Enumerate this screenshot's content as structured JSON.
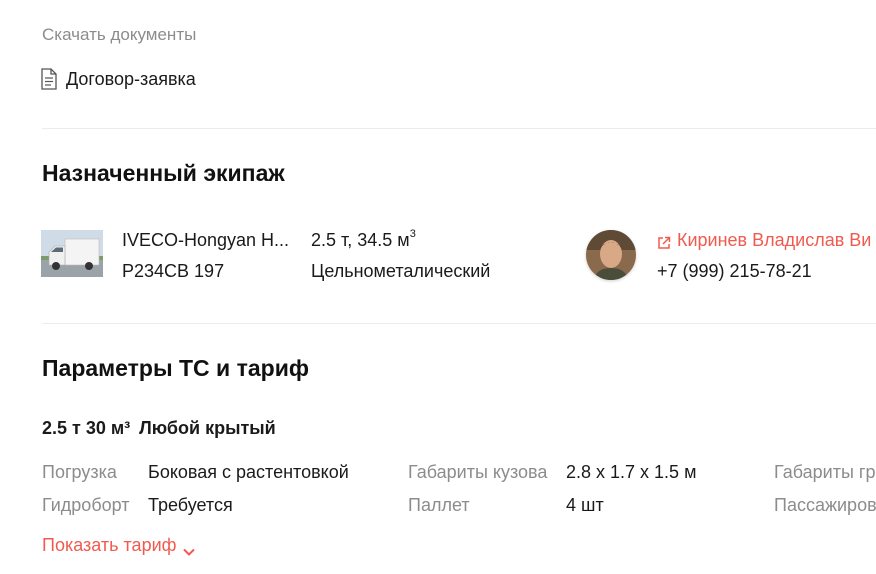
{
  "documents": {
    "label": "Скачать документы",
    "items": [
      {
        "name": "Договор-заявка",
        "icon": "document-icon"
      }
    ]
  },
  "crew": {
    "title": "Назначенный экипаж",
    "vehicle": {
      "name": "IVECO-Hongyan H...",
      "plate": "Р234СВ 197",
      "capacity": "2.5 т, 34.5 м",
      "capacity_sup": "3",
      "body_type": "Цельнометалический"
    },
    "driver": {
      "name": "Киринев Владислав Ви",
      "phone": "+7 (999) 215-78-21",
      "link_icon": "external-link-icon"
    }
  },
  "params": {
    "title": "Параметры ТС и тариф",
    "tariff_size": "2.5 т 30 м³",
    "tariff_type": "Любой крытый",
    "rows": [
      [
        {
          "label": "Погрузка",
          "value": "Боковая с растентовкой"
        },
        {
          "label": "Габариты кузова",
          "value": "2.8 x 1.7 x 1.5 м"
        },
        {
          "label": "Габариты гр",
          "value": ""
        }
      ],
      [
        {
          "label": "Гидроборт",
          "value": "Требуется"
        },
        {
          "label": "Паллет",
          "value": "4 шт"
        },
        {
          "label": "Пассажиров",
          "value": ""
        }
      ]
    ],
    "show_tariff": "Показать тариф"
  },
  "colors": {
    "accent": "#f05a4f",
    "muted_text": "#8c8c8c",
    "divider": "#ececec"
  }
}
